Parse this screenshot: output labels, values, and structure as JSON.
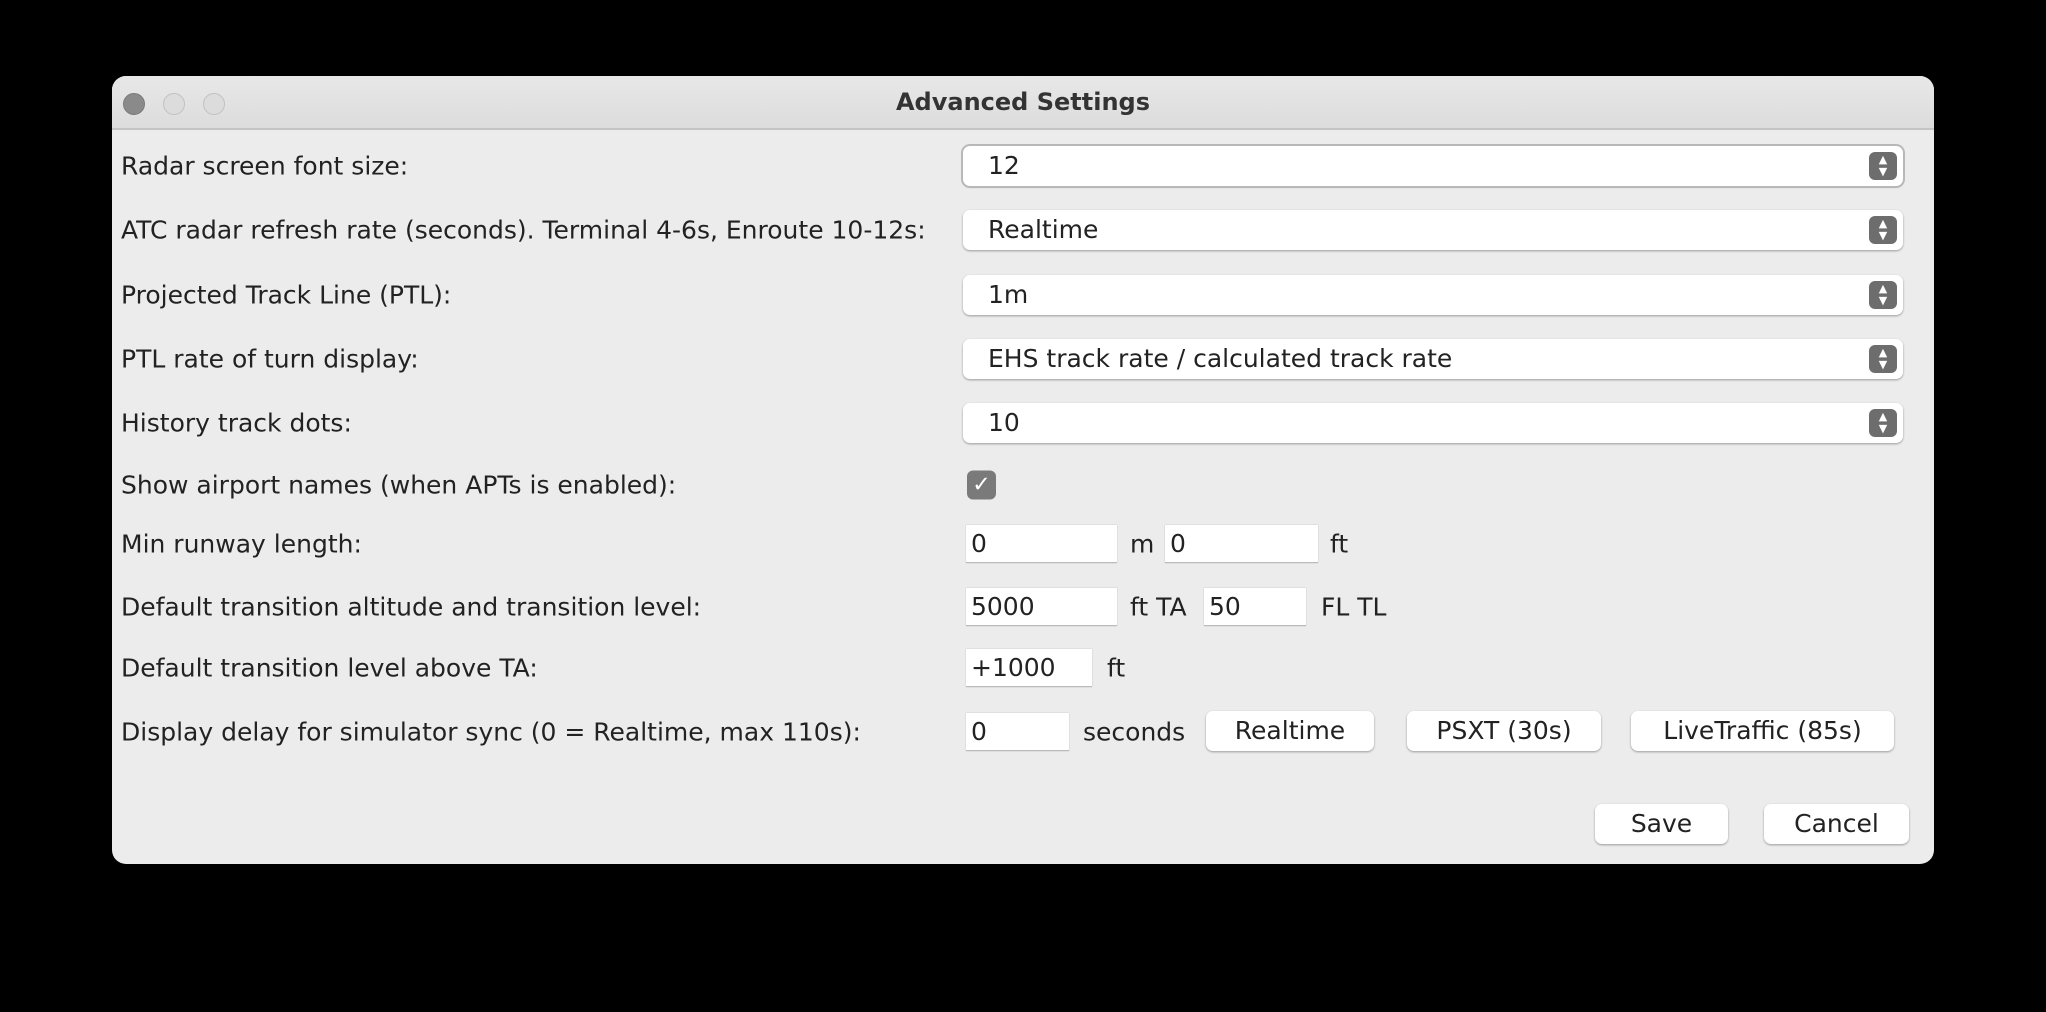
{
  "window": {
    "title": "Advanced Settings"
  },
  "rows": {
    "font_size": {
      "label": "Radar screen font size:",
      "value": "12"
    },
    "refresh": {
      "label": "ATC radar refresh rate (seconds). Terminal 4-6s, Enroute 10-12s:",
      "value": "Realtime"
    },
    "ptl": {
      "label": "Projected Track Line (PTL):",
      "value": "1m"
    },
    "ptl_turn": {
      "label": "PTL rate of turn display:",
      "value": "EHS track rate / calculated track rate"
    },
    "history": {
      "label": "History track dots:",
      "value": "10"
    },
    "airport_names": {
      "label": "Show airport names (when APTs is enabled):",
      "checked": true
    },
    "runway": {
      "label": "Min runway length:",
      "meters": "0",
      "unit_m": "m",
      "feet": "0",
      "unit_ft": "ft"
    },
    "transition": {
      "label": "Default transition altitude and transition level:",
      "ta": "5000",
      "unit_ta": "ft TA",
      "tl": "50",
      "unit_tl": "FL TL"
    },
    "tl_above": {
      "label": "Default transition level above TA:",
      "value": "+1000",
      "unit": "ft"
    },
    "delay": {
      "label": "Display delay for simulator sync (0 = Realtime, max 110s):",
      "value": "0",
      "unit": "seconds",
      "presets": [
        "Realtime",
        "PSXT (30s)",
        "LiveTraffic (85s)"
      ]
    }
  },
  "footer": {
    "save": "Save",
    "cancel": "Cancel"
  }
}
